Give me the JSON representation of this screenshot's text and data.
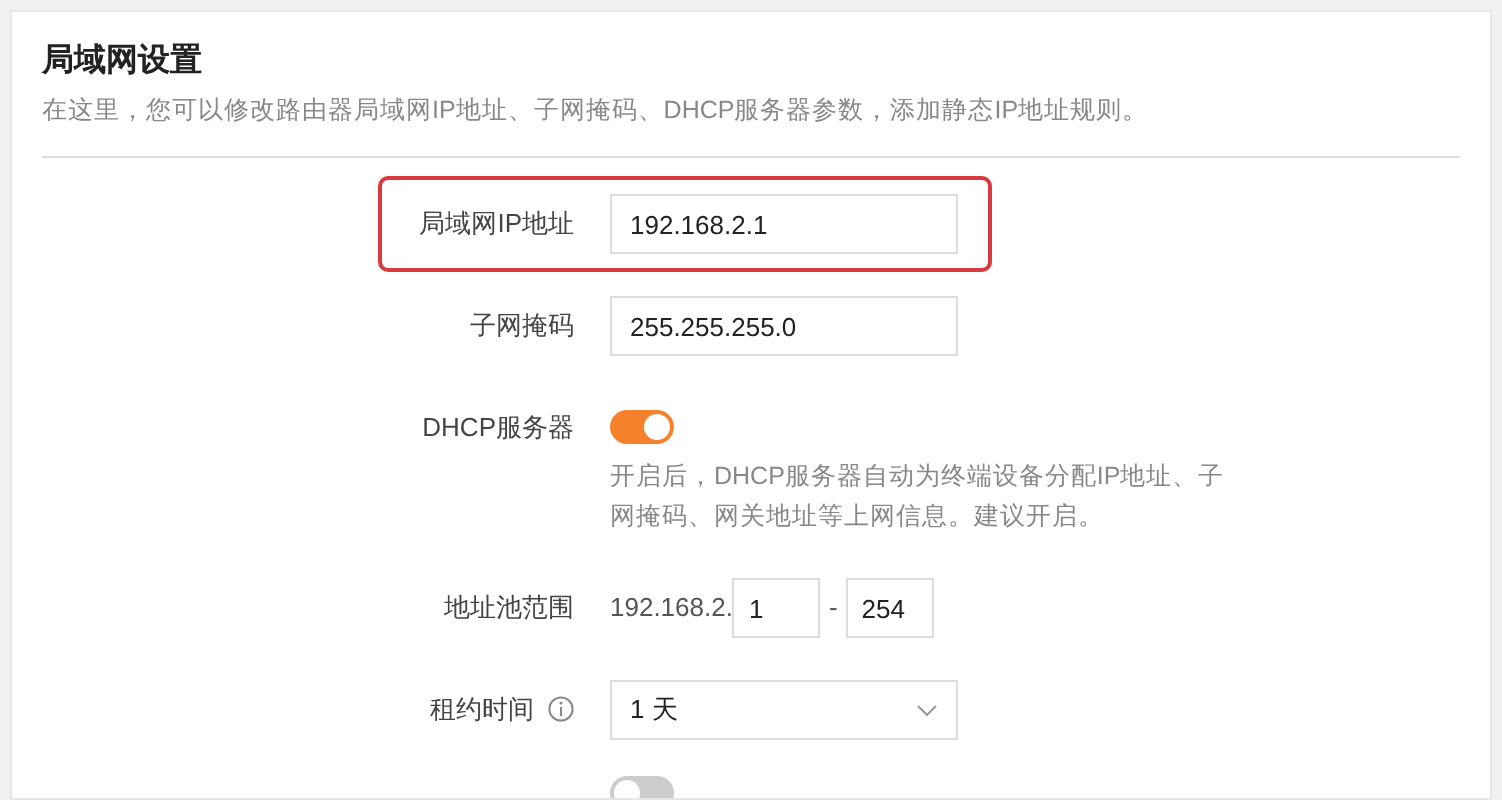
{
  "title": "局域网设置",
  "subtitle": "在这里，您可以修改路由器局域网IP地址、子网掩码、DHCP服务器参数，添加静态IP地址规则。",
  "fields": [
    {
      "kind": "text",
      "label": "局域网IP地址",
      "value": "192.168.2.1",
      "highlighted": true
    },
    {
      "kind": "text",
      "label": "子网掩码",
      "value": "255.255.255.0",
      "highlighted": false
    },
    {
      "kind": "toggle",
      "label": "DHCP服务器",
      "on": true,
      "help": "开启后，DHCP服务器自动为终端设备分配IP地址、子网掩码、网关地址等上网信息。建议开启。"
    },
    {
      "kind": "range",
      "label": "地址池范围",
      "prefix": "192.168.2.",
      "start": "1",
      "separator": "-",
      "end": "254"
    },
    {
      "kind": "select",
      "label": "租约时间",
      "info": true,
      "value": "1 天"
    },
    {
      "kind": "toggle",
      "on": false
    }
  ]
}
